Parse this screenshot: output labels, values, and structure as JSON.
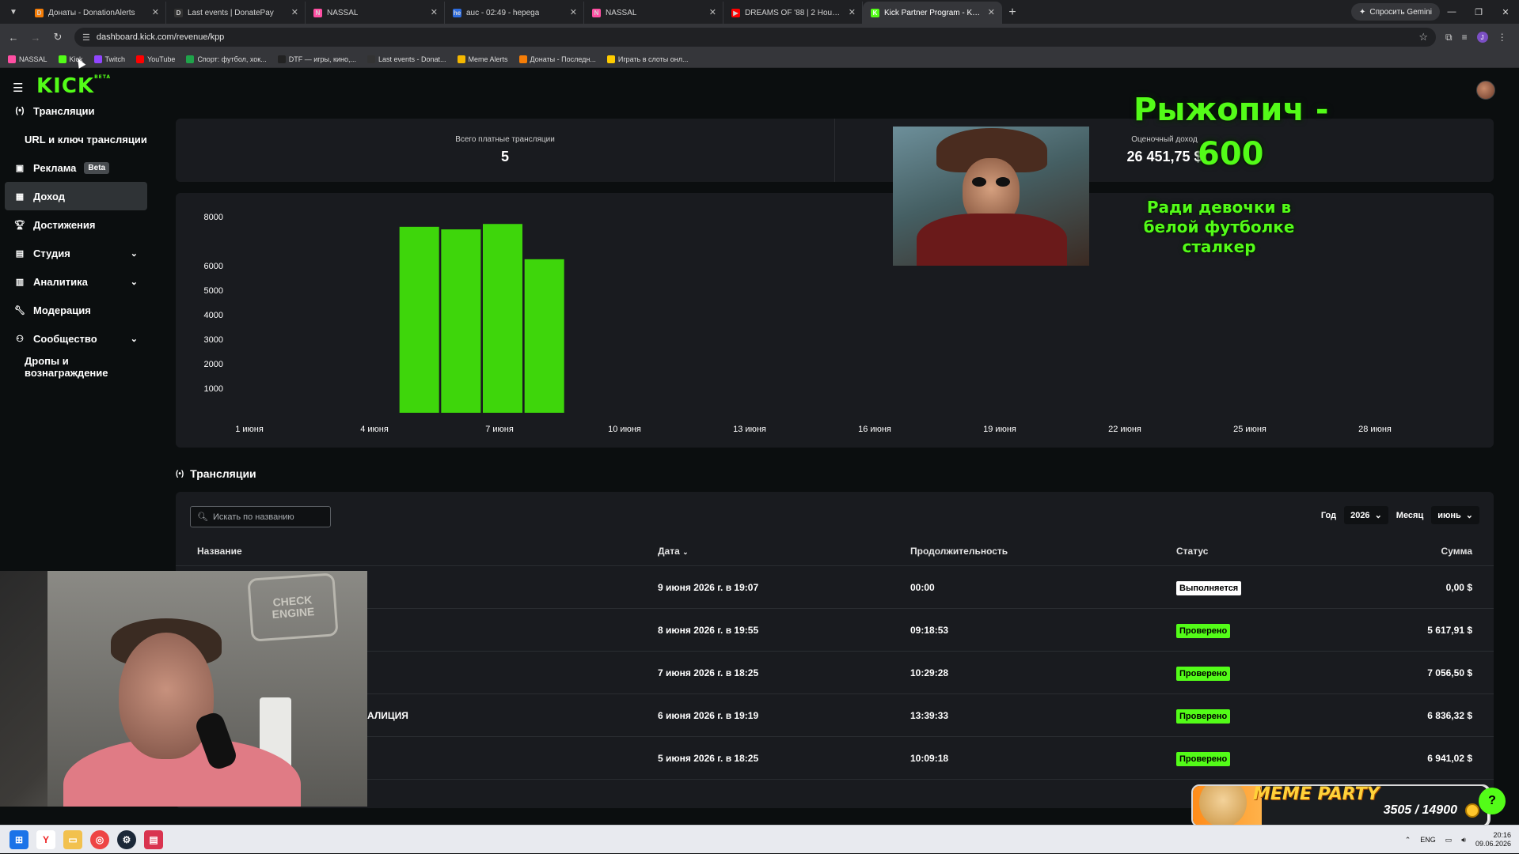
{
  "browser": {
    "tabs": [
      {
        "title": "Донаты - DonationAlerts",
        "fav": "D",
        "fav_color": "#f57d07",
        "active": false
      },
      {
        "title": "Last events | DonatePay",
        "fav": "D",
        "fav_color": "#333333",
        "active": false
      },
      {
        "title": "NASSAL",
        "fav": "N",
        "fav_color": "#ff4fa3",
        "active": false
      },
      {
        "title": "auc - 02:49 - hepega",
        "fav": "he",
        "fav_color": "#2d6cdf",
        "active": false
      },
      {
        "title": "NASSAL",
        "fav": "N",
        "fav_color": "#ff4fa3",
        "active": false
      },
      {
        "title": "DREAMS OF '88 | 2 Hour Sy...",
        "fav": "▶",
        "fav_color": "#ff0000",
        "active": false
      },
      {
        "title": "Kick Partner Program - Kick Da...",
        "fav": "K",
        "fav_color": "#53fc18",
        "active": true
      }
    ],
    "gemini_label": "Спросить Gemini",
    "url": "dashboard.kick.com/revenue/kpp",
    "profile_initial": "J",
    "bookmarks": [
      {
        "label": "NASSAL",
        "color": "#ff4fa3"
      },
      {
        "label": "Kick",
        "color": "#53fc18"
      },
      {
        "label": "Twitch",
        "color": "#9146ff"
      },
      {
        "label": "YouTube",
        "color": "#ff0000"
      },
      {
        "label": "Спорт: футбол, хок...",
        "color": "#1fa34a"
      },
      {
        "label": "DTF — игры, кино,...",
        "color": "#222222"
      },
      {
        "label": "Last events - Donat...",
        "color": "#333333"
      },
      {
        "label": "Meme Alerts",
        "color": "#f5b800"
      },
      {
        "label": "Донаты - Последн...",
        "color": "#f57d07"
      },
      {
        "label": "Играть в слоты онл...",
        "color": "#ffcc00"
      }
    ]
  },
  "sidebar": {
    "logo": "KICK",
    "logo_badge": "BETA",
    "items": [
      {
        "label": "Трансляции",
        "icon": "broadcast-icon"
      },
      {
        "label": "URL и ключ трансляции",
        "icon": ""
      },
      {
        "label": "Реклама",
        "icon": "ads-icon",
        "badge": "Beta"
      },
      {
        "label": "Доход",
        "icon": "revenue-icon",
        "active": true
      },
      {
        "label": "Достижения",
        "icon": "trophy-icon"
      },
      {
        "label": "Студия",
        "icon": "studio-icon",
        "chevron": true
      },
      {
        "label": "Аналитика",
        "icon": "analytics-icon",
        "chevron": true
      },
      {
        "label": "Модерация",
        "icon": "wrench-icon"
      },
      {
        "label": "Сообщество",
        "icon": "community-icon",
        "chevron": true
      },
      {
        "label": "Дропы и вознаграждение",
        "icon": ""
      }
    ]
  },
  "stats": {
    "paid_streams_label": "Всего платные трансляции",
    "paid_streams_value": "5",
    "estimated_income_label": "Оценочный доход",
    "estimated_income_value": "26 451,75 $"
  },
  "chart_data": {
    "type": "bar",
    "color": "#3ed60b",
    "x_tick_labels": [
      "1 июня",
      "4 июня",
      "7 июня",
      "10 июня",
      "13 июня",
      "16 июня",
      "19 июня",
      "22 июня",
      "25 июня",
      "28 июня"
    ],
    "y_tick_labels": [
      1000,
      2000,
      3000,
      4000,
      5000,
      6000,
      8000
    ],
    "bars": [
      {
        "date": "5 июня",
        "value": 6941.02
      },
      {
        "date": "6 июня",
        "value": 6836.32
      },
      {
        "date": "7 июня",
        "value": 7056.5
      },
      {
        "date": "8 июня",
        "value": 5617.91
      }
    ]
  },
  "streams": {
    "title": "Трансляции",
    "search_placeholder": "Искать по названию",
    "year_label": "Год",
    "year_value": "2026",
    "month_label": "Месяц",
    "month_value": "июнь",
    "columns": {
      "name": "Название",
      "date": "Дата",
      "duration": "Продолжительность",
      "status": "Статус",
      "sum": "Сумма"
    },
    "rows": [
      {
        "name": "",
        "date": "9 июня 2026 г. в 19:07",
        "duration": "00:00",
        "status": "Выполняется",
        "status_kind": "run",
        "sum": "0,00 $"
      },
      {
        "name": "",
        "date": "8 июня 2026 г. в 19:55",
        "duration": "09:18:53",
        "status": "Проверено",
        "status_kind": "ok",
        "sum": "5 617,91 $"
      },
      {
        "name": "",
        "date": "7 июня 2026 г. в 18:25",
        "duration": "10:29:28",
        "status": "Проверено",
        "status_kind": "ok",
        "sum": "7 056,50 $"
      },
      {
        "name": "АЛИЦИЯ",
        "date": "6 июня 2026 г. в 19:19",
        "duration": "13:39:33",
        "status": "Проверено",
        "status_kind": "ok",
        "sum": "6 836,32 $"
      },
      {
        "name": "",
        "date": "5 июня 2026 г. в 18:25",
        "duration": "10:09:18",
        "status": "Проверено",
        "status_kind": "ok",
        "sum": "6 941,02 $"
      }
    ]
  },
  "overlay": {
    "webcam_sign": "CHECK ENGINE",
    "donor_name": "Рыжопич -",
    "donor_amount": "600",
    "donor_message": "Ради девочки в белой футболке сталкер",
    "meme_title": "MEME PARTY",
    "meme_counter": "3505 / 14900",
    "meme_progress": 0.235
  },
  "taskbar": {
    "lang": "ENG",
    "time": "20:16",
    "date": "09.06.2026"
  }
}
